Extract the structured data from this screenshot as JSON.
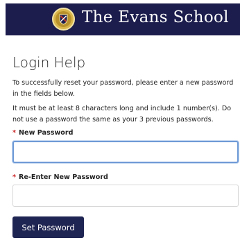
{
  "header": {
    "school_name": "The Evans School",
    "crest_icon": "school-crest-icon"
  },
  "page": {
    "title": "Login Help",
    "intro": "To successfully reset your password, please enter a new password in the fields below.",
    "requirements": "It must be at least 8 characters long and include 1 number(s). Do not use a password the same as your 3 previous passwords."
  },
  "form": {
    "required_marker": "*",
    "new_password_label": "New Password",
    "new_password_value": "",
    "reenter_password_label": "Re-Enter New Password",
    "reenter_password_value": "",
    "submit_label": "Set Password"
  },
  "colors": {
    "header_bg": "#1c1d4d",
    "button_bg": "#1f2552",
    "required": "#cc2a2a",
    "focus_border": "#6f9ad6"
  }
}
